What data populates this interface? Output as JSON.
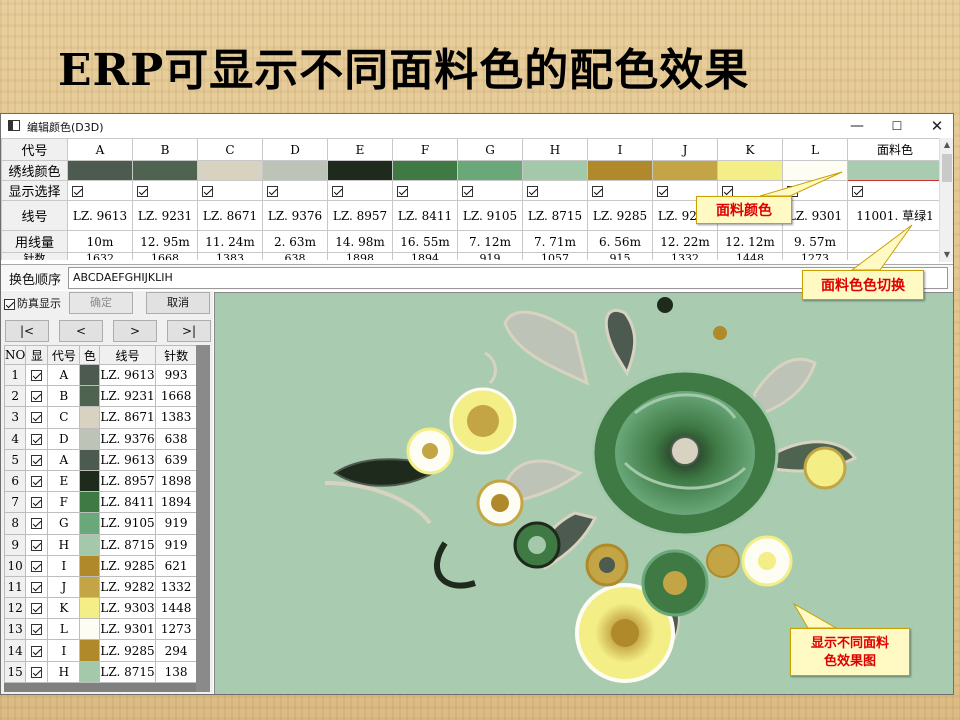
{
  "slide": {
    "title": "ERP可显示不同面料色的配色效果"
  },
  "window": {
    "title": "编辑颜色(D3D)",
    "minimize": "—",
    "maximize": "☐",
    "close": "✕"
  },
  "color_grid": {
    "row_labels": {
      "code": "代号",
      "color": "绣线颜色",
      "show": "显示选择",
      "thread": "线号",
      "length": "用线量",
      "stitches": "针数"
    },
    "columns": [
      {
        "code": "A",
        "color": "#4d5a50",
        "thread": "LZ. 9613",
        "length": "10m",
        "stitches": "1632"
      },
      {
        "code": "B",
        "color": "#4f6450",
        "thread": "LZ. 9231",
        "length": "12. 95m",
        "stitches": "1668"
      },
      {
        "code": "C",
        "color": "#d8d2c0",
        "thread": "LZ. 8671",
        "length": "11. 24m",
        "stitches": "1383"
      },
      {
        "code": "D",
        "color": "#bdc3b6",
        "thread": "LZ. 9376",
        "length": "2. 63m",
        "stitches": "638"
      },
      {
        "code": "E",
        "color": "#1e2a1c",
        "thread": "LZ. 8957",
        "length": "14. 98m",
        "stitches": "1898"
      },
      {
        "code": "F",
        "color": "#3f7a45",
        "thread": "LZ. 8411",
        "length": "16. 55m",
        "stitches": "1894"
      },
      {
        "code": "G",
        "color": "#6aa87a",
        "thread": "LZ. 9105",
        "length": "7. 12m",
        "stitches": "919"
      },
      {
        "code": "H",
        "color": "#a3c9aa",
        "thread": "LZ. 8715",
        "length": "7. 71m",
        "stitches": "1057"
      },
      {
        "code": "I",
        "color": "#b08a2a",
        "thread": "LZ. 9285",
        "length": "6. 56m",
        "stitches": "915"
      },
      {
        "code": "J",
        "color": "#c3a545",
        "thread": "LZ. 9282",
        "length": "12. 22m",
        "stitches": "1332"
      },
      {
        "code": "K",
        "color": "#f3ee86",
        "thread": "LZ. 9303",
        "length": "12. 12m",
        "stitches": "1448"
      },
      {
        "code": "L",
        "color": "#fdfdf4",
        "thread": "LZ. 9301",
        "length": "9. 57m",
        "stitches": "1273"
      }
    ],
    "fabric": {
      "header": "面料色",
      "color": "#a9ccb0",
      "thread": "11001. 草绿1"
    }
  },
  "order": {
    "label": "换色顺序",
    "value": "ABCDAEFGHIJKLIH"
  },
  "panel": {
    "simulate_label": "防真显示",
    "ok_label": "确定",
    "cancel_label": "取消",
    "nav_first": "|<",
    "nav_prev": "<",
    "nav_next": ">",
    "nav_last": ">|"
  },
  "thread_list": {
    "headers": {
      "no": "NO",
      "show": "显",
      "code": "代号",
      "color": "色",
      "thread": "线号",
      "stitches": "针数"
    },
    "rows": [
      {
        "no": "1",
        "code": "A",
        "color": "#4d5a50",
        "thread": "LZ. 9613",
        "stitches": "993"
      },
      {
        "no": "2",
        "code": "B",
        "color": "#4f6450",
        "thread": "LZ. 9231",
        "stitches": "1668"
      },
      {
        "no": "3",
        "code": "C",
        "color": "#d8d2c0",
        "thread": "LZ. 8671",
        "stitches": "1383"
      },
      {
        "no": "4",
        "code": "D",
        "color": "#bdc3b6",
        "thread": "LZ. 9376",
        "stitches": "638"
      },
      {
        "no": "5",
        "code": "A",
        "color": "#4d5a50",
        "thread": "LZ. 9613",
        "stitches": "639"
      },
      {
        "no": "6",
        "code": "E",
        "color": "#1e2a1c",
        "thread": "LZ. 8957",
        "stitches": "1898"
      },
      {
        "no": "7",
        "code": "F",
        "color": "#3f7a45",
        "thread": "LZ. 8411",
        "stitches": "1894"
      },
      {
        "no": "8",
        "code": "G",
        "color": "#6aa87a",
        "thread": "LZ. 9105",
        "stitches": "919"
      },
      {
        "no": "9",
        "code": "H",
        "color": "#a3c9aa",
        "thread": "LZ. 8715",
        "stitches": "919"
      },
      {
        "no": "10",
        "code": "I",
        "color": "#b08a2a",
        "thread": "LZ. 9285",
        "stitches": "621"
      },
      {
        "no": "11",
        "code": "J",
        "color": "#c3a545",
        "thread": "LZ. 9282",
        "stitches": "1332"
      },
      {
        "no": "12",
        "code": "K",
        "color": "#f3ee86",
        "thread": "LZ. 9303",
        "stitches": "1448"
      },
      {
        "no": "13",
        "code": "L",
        "color": "#fdfdf4",
        "thread": "LZ. 9301",
        "stitches": "1273"
      },
      {
        "no": "14",
        "code": "I",
        "color": "#b08a2a",
        "thread": "LZ. 9285",
        "stitches": "294"
      },
      {
        "no": "15",
        "code": "H",
        "color": "#a3c9aa",
        "thread": "LZ. 8715",
        "stitches": "138"
      }
    ]
  },
  "callouts": {
    "fabric_color": "面料颜色",
    "fabric_switch": "面料色色切换",
    "effect_line1": "显示不同面料",
    "effect_line2": "色效果图"
  },
  "icons": {
    "app": "window-app-icon",
    "checkbox": "checkbox-checked-icon",
    "scroll_up": "▲",
    "scroll_down": "▼"
  }
}
